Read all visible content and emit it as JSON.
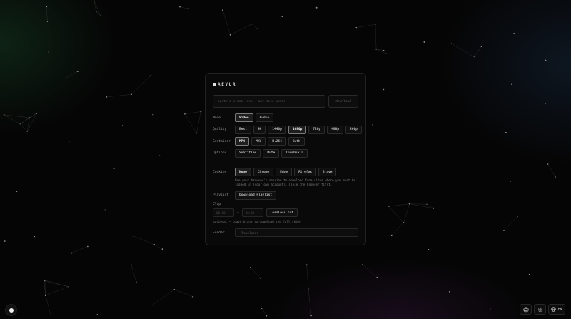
{
  "app": {
    "brand": "AEVUR"
  },
  "url_bar": {
    "placeholder": "paste a video link — any site works",
    "download_label": "download"
  },
  "mode": {
    "label": "Mode",
    "options": [
      "Video",
      "Audio"
    ],
    "selected": "Video"
  },
  "quality": {
    "label": "Quality",
    "options": [
      "Best",
      "4K",
      "1440p",
      "1080p",
      "720p",
      "480p",
      "360p"
    ],
    "selected": "1080p"
  },
  "container": {
    "label": "Container",
    "options": [
      "MP4",
      "MKV",
      "H.264",
      "Both"
    ],
    "selected": "MP4"
  },
  "options_row": {
    "label": "Options",
    "options": [
      "Subtitles",
      "Mute",
      "Thumbnail"
    ]
  },
  "cookies": {
    "label": "Cookies",
    "options": [
      "None",
      "Chrome",
      "Edge",
      "Firefox",
      "Brave"
    ],
    "selected": "None",
    "hint": "Use your browser's session to download from sites where you must be logged in (your own account). Close the browser first."
  },
  "playlist": {
    "label": "Playlist",
    "button_label": "Download Playlist"
  },
  "clip": {
    "label": "Clip",
    "start_placeholder": "00:00",
    "end_placeholder": "00:00",
    "separator": "—",
    "lossless_label": "Lossless cut",
    "hint": "optional — leave blank to download the full video"
  },
  "folder": {
    "label": "Folder",
    "placeholder": "~/Downloads"
  },
  "footer": {
    "language_label": "EN"
  },
  "colors": {
    "background": "#050505",
    "panel": "#0a0a0a",
    "chip_active_border": "#7a7a7a"
  },
  "icons": [
    "theme-toggle-icon",
    "github-icon",
    "settings-icon",
    "globe-icon"
  ]
}
